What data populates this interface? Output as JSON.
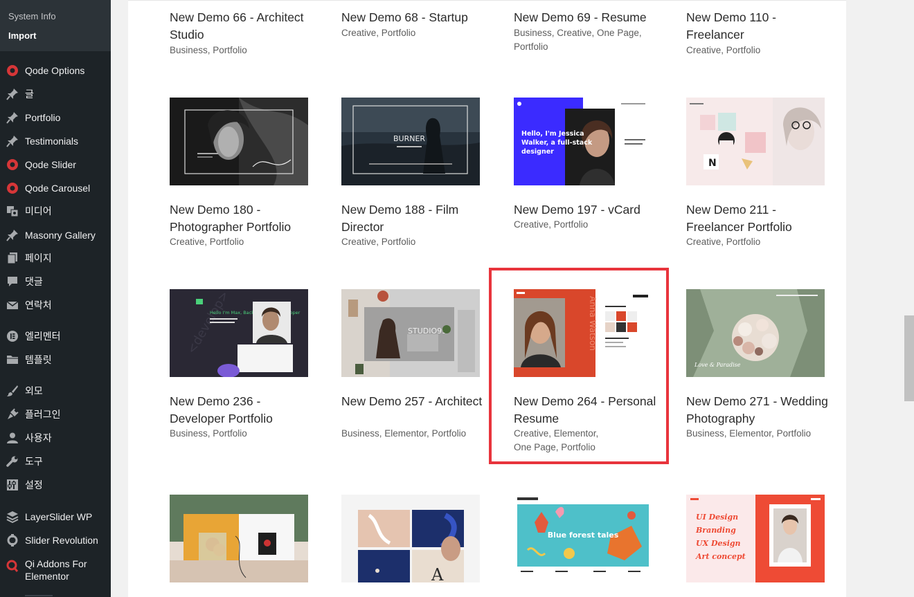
{
  "sidebar": {
    "submenu": [
      {
        "label": "System Info"
      },
      {
        "label": "Import"
      }
    ],
    "items": [
      {
        "label": "Qode Options",
        "icon": "qode-icon"
      },
      {
        "label": "글",
        "icon": "pin-icon"
      },
      {
        "label": "Portfolio",
        "icon": "pin-icon"
      },
      {
        "label": "Testimonials",
        "icon": "pin-icon"
      },
      {
        "label": "Qode Slider",
        "icon": "qode-icon"
      },
      {
        "label": "Qode Carousel",
        "icon": "qode-icon"
      },
      {
        "label": "미디어",
        "icon": "media-icon"
      },
      {
        "label": "Masonry Gallery",
        "icon": "pin-icon"
      },
      {
        "label": "페이지",
        "icon": "page-icon"
      },
      {
        "label": "댓글",
        "icon": "comment-icon"
      },
      {
        "label": "연락처",
        "icon": "mail-icon"
      },
      {
        "label": "엘리멘터",
        "icon": "elementor-icon"
      },
      {
        "label": "템플릿",
        "icon": "folder-icon"
      },
      {
        "label": "외모",
        "icon": "brush-icon"
      },
      {
        "label": "플러그인",
        "icon": "plugin-icon"
      },
      {
        "label": "사용자",
        "icon": "user-icon"
      },
      {
        "label": "도구",
        "icon": "wrench-icon"
      },
      {
        "label": "설정",
        "icon": "settings-icon"
      },
      {
        "label": "LayerSlider WP",
        "icon": "layers-icon"
      },
      {
        "label": "Slider Revolution",
        "icon": "revolution-icon"
      },
      {
        "label": "Qi Addons For Elementor",
        "icon": "qi-icon"
      }
    ]
  },
  "colors": {
    "sidebar_bg": "#1d2327",
    "qode_red": "#d63638",
    "highlight": "#e8343c"
  },
  "demos": [
    {
      "title": "New Demo 66 - Architect Studio",
      "tags": "Business,  Portfolio"
    },
    {
      "title": "New Demo 68 - Startup",
      "tags": "Creative,  Portfolio"
    },
    {
      "title": "New Demo 69 - Resume",
      "tags": "Business,  Creative,  One Page,  Portfolio"
    },
    {
      "title": "New Demo 110 - Freelancer",
      "tags": "Creative,  Portfolio"
    },
    {
      "title": "New Demo 180 - Photographer Portfolio",
      "tags": "Creative,  Portfolio"
    },
    {
      "title": "New Demo 188 - Film Director",
      "tags": "Creative,  Portfolio"
    },
    {
      "title": "New Demo 197 - vCard",
      "tags": "Creative,  Portfolio"
    },
    {
      "title": "New Demo 211 - Freelancer Portfolio",
      "tags": "Creative,  Portfolio"
    },
    {
      "title": "New Demo 236 - Developer Portfolio",
      "tags": "Business,  Portfolio"
    },
    {
      "title": "New Demo 257 - Architect",
      "tags": "Business,  Elementor,  Portfolio"
    },
    {
      "title": "New Demo 264 - Personal Resume",
      "tags": "Creative,  Elementor,  One Page,  Portfolio"
    },
    {
      "title": "New Demo 271 - Wedding Photography",
      "tags": "Business,  Elementor,  Portfolio"
    }
  ],
  "thumb_text": {
    "burner": "BURNER",
    "jessica_line1": "Hello, I'm Jessica",
    "jessica_line2": "Walker, a full-stack",
    "jessica_line3": "designer",
    "developer": "<develop>",
    "dev_hello": "Hello I'm Max, Back-end Web Developer",
    "studio": "STUDIO99",
    "wedding": "Love & Paradise",
    "anna": "Anna Watson",
    "blue_forest": "Blue forest tales",
    "ui_design": "UI Design",
    "branding": "Branding",
    "ux_design": "UX Design",
    "art_concept": "Art concept"
  }
}
